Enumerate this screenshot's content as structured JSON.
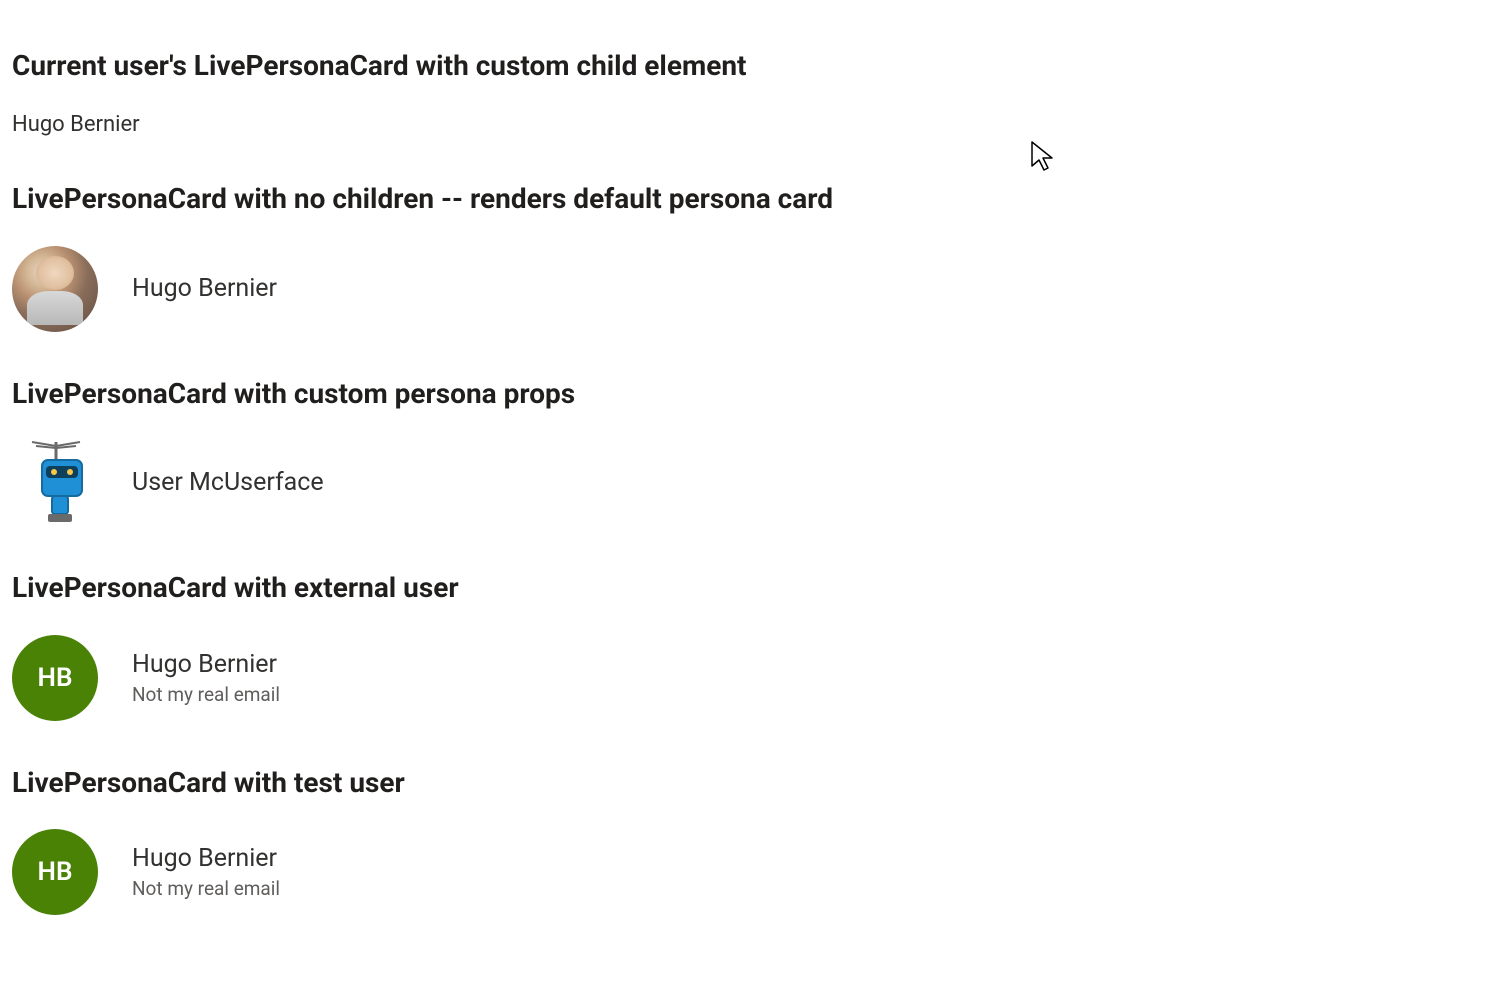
{
  "sections": [
    {
      "heading": "Current user's LivePersonaCard with custom child element",
      "simple_text": "Hugo Bernier"
    },
    {
      "heading": "LivePersonaCard with no children -- renders default persona card",
      "persona": {
        "avatar_type": "photo",
        "primary": "Hugo Bernier"
      }
    },
    {
      "heading": "LivePersonaCard with custom persona props",
      "persona": {
        "avatar_type": "robot",
        "primary": "User McUserface"
      }
    },
    {
      "heading": "LivePersonaCard with external user",
      "persona": {
        "avatar_type": "initials",
        "initials": "HB",
        "primary": "Hugo Bernier",
        "secondary": "Not my real email"
      }
    },
    {
      "heading": "LivePersonaCard with test user",
      "persona": {
        "avatar_type": "initials",
        "initials": "HB",
        "primary": "Hugo Bernier",
        "secondary": "Not my real email"
      }
    }
  ]
}
